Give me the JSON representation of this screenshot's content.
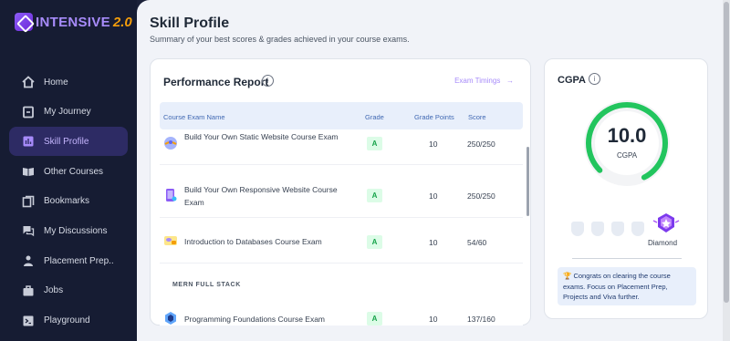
{
  "app": {
    "brand": "INTENSIVE",
    "version": "2.0"
  },
  "sidebar": {
    "items": [
      {
        "label": "Home",
        "icon": "home-icon",
        "active": false
      },
      {
        "label": "My Journey",
        "icon": "journey-icon",
        "active": false
      },
      {
        "label": "Skill Profile",
        "icon": "skill-profile-icon",
        "active": true
      },
      {
        "label": "Other Courses",
        "icon": "book-icon",
        "active": false
      },
      {
        "label": "Bookmarks",
        "icon": "bookmark-icon",
        "active": false
      },
      {
        "label": "My Discussions",
        "icon": "discussion-icon",
        "active": false
      },
      {
        "label": "Placement Prep..",
        "icon": "placement-icon",
        "active": false
      },
      {
        "label": "Jobs",
        "icon": "briefcase-icon",
        "active": false
      },
      {
        "label": "Playground",
        "icon": "terminal-icon",
        "active": false
      }
    ]
  },
  "header": {
    "title": "Skill Profile",
    "subtitle": "Summary of your best scores & grades achieved in your course exams."
  },
  "performance": {
    "title": "Performance Report",
    "exam_link": "Exam Timings",
    "columns": [
      "Course Exam Name",
      "Grade",
      "Grade Points",
      "Score"
    ],
    "rows": [
      {
        "name": "Build Your Own Static Website Course Exam",
        "grade": "A",
        "points": "10",
        "score": "250/250"
      },
      {
        "name": "Build Your Own Responsive Website Course Exam",
        "grade": "A",
        "points": "10",
        "score": "250/250"
      },
      {
        "name": "Introduction to Databases Course Exam",
        "grade": "A",
        "points": "10",
        "score": "54/60"
      }
    ],
    "section": "MERN FULL STACK",
    "section_rows": [
      {
        "name": "Programming Foundations Course Exam",
        "grade": "A",
        "points": "10",
        "score": "137/160"
      }
    ]
  },
  "cgpa": {
    "title": "CGPA",
    "value": "10.0",
    "label": "CGPA",
    "level": "Diamond",
    "message": "Congrats on clearing the course exams. Focus on Placement Prep, Projects and Viva further."
  },
  "colors": {
    "accent": "#a78bfa",
    "gauge": "#22c55e",
    "sidebar": "#161c33"
  }
}
